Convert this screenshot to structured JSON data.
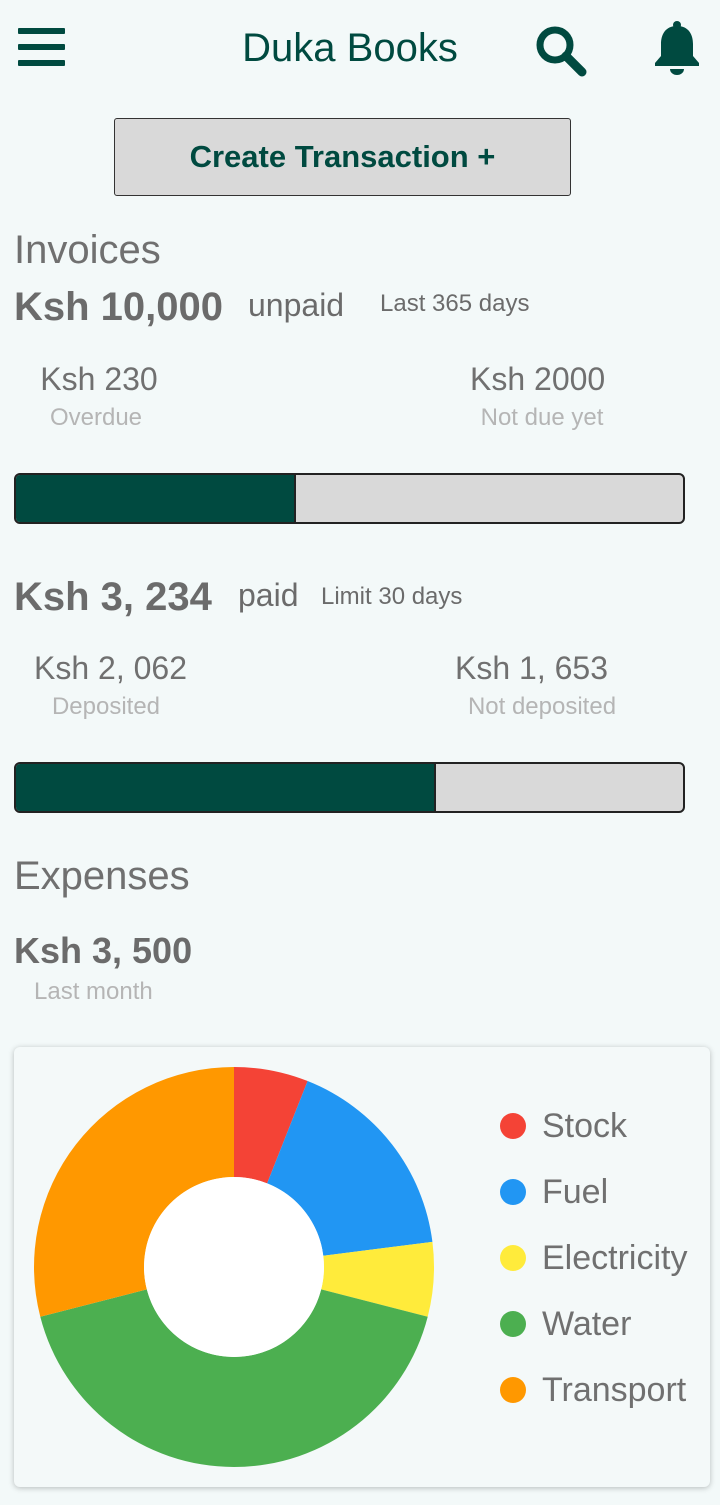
{
  "header": {
    "title": "Duka Books",
    "menu_icon": "menu-icon",
    "search_icon": "search-icon",
    "notification_icon": "bell-icon"
  },
  "actions": {
    "create_transaction_label": "Create Transaction +"
  },
  "invoices": {
    "title": "Invoices",
    "unpaid": {
      "amount": "Ksh 10,000",
      "label": "unpaid",
      "period": "Last 365 days",
      "overdue_amount": "Ksh 230",
      "overdue_label": "Overdue",
      "not_due_amount": "Ksh 2000",
      "not_due_label": "Not due yet",
      "progress_fraction": 0.42
    },
    "paid": {
      "amount": "Ksh 3, 234",
      "label": "paid",
      "period": "Limit 30 days",
      "deposited_amount": "Ksh 2, 062",
      "deposited_label": "Deposited",
      "not_deposited_amount": "Ksh 1, 653",
      "not_deposited_label": "Not deposited",
      "progress_fraction": 0.63
    }
  },
  "expenses": {
    "title": "Expenses",
    "amount": "Ksh 3, 500",
    "period": "Last month"
  },
  "colors": {
    "brand": "#004a40",
    "bar_track": "#d9d9d9"
  },
  "chart_data": {
    "type": "pie",
    "donut": true,
    "categories": [
      "Stock",
      "Fuel",
      "Electricity",
      "Water",
      "Transport"
    ],
    "values": [
      6,
      17,
      6,
      42,
      29
    ],
    "colors": [
      "#f44336",
      "#2196f3",
      "#ffeb3b",
      "#4caf50",
      "#ff9800"
    ],
    "legend_position": "right",
    "start_angle_deg": 0
  }
}
